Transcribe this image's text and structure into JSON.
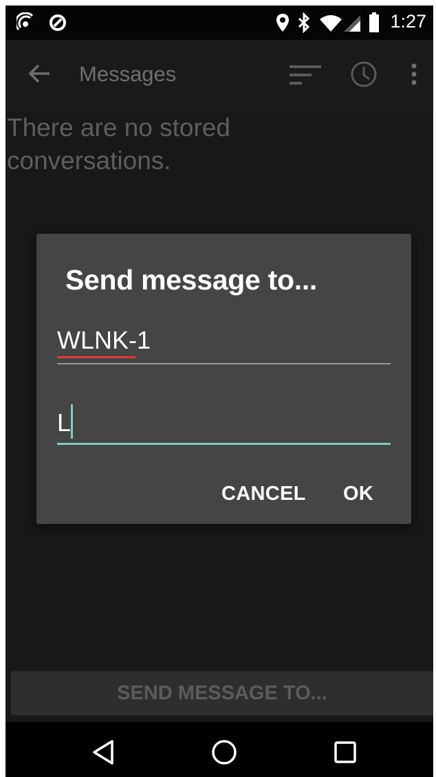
{
  "status_bar": {
    "time": "1:27",
    "left_icons": [
      "hotspot-icon",
      "shield-icon"
    ],
    "right_icons": [
      "location-icon",
      "bluetooth-icon",
      "wifi-icon",
      "signal-icon",
      "battery-icon"
    ]
  },
  "app_bar": {
    "title": "Messages",
    "back_icon": "arrow-left-icon",
    "actions": [
      "sort-icon",
      "clock-icon",
      "more-vert-icon"
    ]
  },
  "main": {
    "empty_message": "There are no stored conversations."
  },
  "dialog": {
    "title": "Send message to...",
    "recipient_value": "WLNK-1",
    "message_value": "L",
    "cancel_label": "CANCEL",
    "ok_label": "OK"
  },
  "bottom_button": {
    "label": "SEND MESSAGE TO..."
  },
  "nav_bar": {
    "buttons": [
      "back-triangle-icon",
      "home-circle-icon",
      "recents-square-icon"
    ]
  },
  "colors": {
    "accent": "#80cbc4",
    "spellcheck": "#e23b3b",
    "dialog_bg": "#454545",
    "screen_bg": "#181818"
  }
}
